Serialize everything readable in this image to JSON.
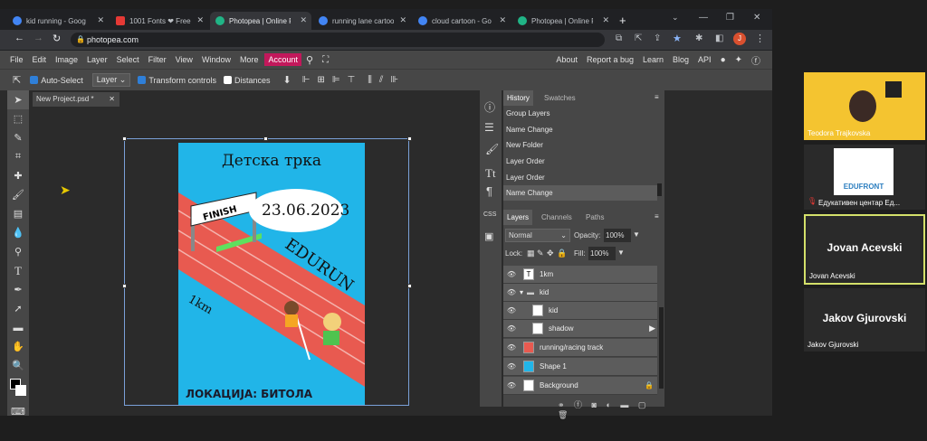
{
  "tabs": [
    {
      "title": "kid running - Goog",
      "color": "#4285f4"
    },
    {
      "title": "1001 Fonts ❤ Free",
      "color": "#e53935"
    },
    {
      "title": "Photopea | Online F",
      "color": "#20b486",
      "active": true
    },
    {
      "title": "running lane cartoo",
      "color": "#4285f4"
    },
    {
      "title": "cloud cartoon - Go",
      "color": "#4285f4"
    },
    {
      "title": "Photopea | Online F",
      "color": "#20b486"
    }
  ],
  "url": "photopea.com",
  "avatar_letter": "J",
  "menu": [
    "File",
    "Edit",
    "Image",
    "Layer",
    "Select",
    "Filter",
    "View",
    "Window",
    "More"
  ],
  "account": "Account",
  "menu_right": [
    "About",
    "Report a bug",
    "Learn",
    "Blog",
    "API"
  ],
  "options": {
    "auto_select": "Auto-Select",
    "layer": "Layer",
    "transform": "Transform controls",
    "distances": "Distances"
  },
  "doc_tab": "New Project.psd *",
  "poster": {
    "title": "Детска трка",
    "date": "23.06.2023",
    "brand": "EDURUN",
    "distance": "1km",
    "finish": "FINISH",
    "location": "ЛОКАЦИЈА: БИТОЛА"
  },
  "history": {
    "tab1": "History",
    "tab2": "Swatches",
    "items": [
      "Group Layers",
      "Name Change",
      "New Folder",
      "Layer Order",
      "Layer Order",
      "Name Change"
    ]
  },
  "layers": {
    "tab1": "Layers",
    "tab2": "Channels",
    "tab3": "Paths",
    "blend": "Normal",
    "opacity_label": "Opacity:",
    "opacity": "100%",
    "lock_label": "Lock:",
    "fill_label": "Fill:",
    "fill": "100%",
    "items": [
      "1km",
      "kid",
      "kid",
      "shadow",
      "running/racing track",
      "Shape 1",
      "Background"
    ]
  },
  "participants": [
    {
      "name": "Teodora Trajkovska"
    },
    {
      "name": "Едукативен центар Ед...",
      "logo": "EDUFRONT"
    },
    {
      "name": "Jovan Acevski",
      "big": "Jovan Acevski"
    },
    {
      "name": "Jakov Gjurovski",
      "big": "Jakov Gjurovski"
    }
  ],
  "colors": {
    "accent": "#c2185b",
    "poster_bg": "#21b5e8",
    "track": "#e85a50"
  }
}
